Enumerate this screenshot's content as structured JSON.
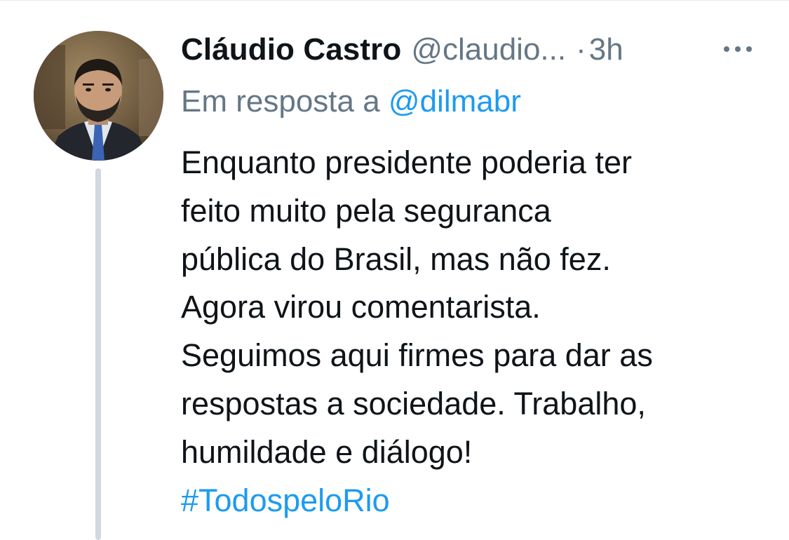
{
  "tweet": {
    "author": {
      "display_name": "Cláudio Castro",
      "handle": "@claudio...",
      "avatar_icon": "profile-photo"
    },
    "separator": "·",
    "timestamp": "3h",
    "more_icon": "more-horizontal-icon",
    "reply_context": {
      "prefix": "Em resposta a",
      "mention": "@dilmabr"
    },
    "text_lines": [
      "Enquanto presidente poderia ter",
      "feito muito pela seguranca",
      "pública do Brasil, mas não fez.",
      "Agora virou comentarista.",
      "Seguimos aqui firmes para dar as",
      "respostas a sociedade. Trabalho,",
      "humildade e diálogo!"
    ],
    "hashtag": "#TodospeloRio"
  },
  "colors": {
    "text_primary": "#0f1419",
    "text_secondary": "#657786",
    "link": "#1d9bf0",
    "thread_line": "#cfd9de"
  }
}
